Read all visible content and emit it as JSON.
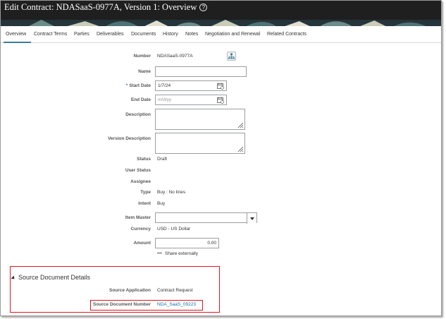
{
  "header": {
    "title": "Edit Contract: NDASaaS-0977A, Version 1: Overview"
  },
  "tabs": [
    {
      "label": "Overview"
    },
    {
      "label": "Contract Terms"
    },
    {
      "label": "Parties"
    },
    {
      "label": "Deliverables"
    },
    {
      "label": "Documents"
    },
    {
      "label": "History"
    },
    {
      "label": "Notes"
    },
    {
      "label": "Negotiation and Renewal"
    },
    {
      "label": "Related Contracts"
    }
  ],
  "active_tab": "Overview",
  "form": {
    "number_label": "Number",
    "number_value": "NDASaaS-0977A",
    "name_label": "Name",
    "name_value": "",
    "start_date_label": "Start Date",
    "start_date_required": "*",
    "start_date_value": "1/7/24",
    "end_date_label": "End Date",
    "end_date_placeholder": "m/d/yy",
    "description_label": "Description",
    "version_description_label": "Version Description",
    "status_label": "Status",
    "status_value": "Draft",
    "user_status_label": "User Status",
    "assignee_label": "Assignee",
    "type_label": "Type",
    "type_value": "Buy : No lines",
    "intent_label": "Intent",
    "intent_value": "Buy",
    "item_master_label": "Item Master",
    "item_master_value": "",
    "currency_label": "Currency",
    "currency_value": "USD - US Dollar",
    "amount_label": "Amount",
    "amount_value": "0.00",
    "share_externally_label": "Share externally",
    "share_externally_checked": false
  },
  "source_section": {
    "title": "Source Document Details",
    "source_application_label": "Source Application",
    "source_application_value": "Contract Request",
    "source_document_number_label": "Source Document Number",
    "source_document_number_value": "NDA_SaaS_09223"
  },
  "colors": {
    "header_bg": "#1f1f1f",
    "accent": "#3a7e9b",
    "highlight_box": "#e0141e",
    "link": "#0f6ea8"
  }
}
